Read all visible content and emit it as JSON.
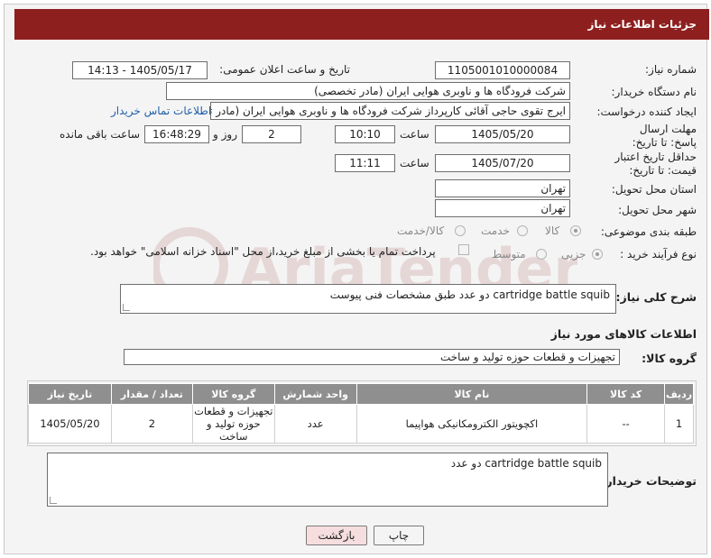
{
  "window": {
    "title": "جزئیات اطلاعات نیاز"
  },
  "fields": {
    "need_number_label": "شماره نیاز:",
    "need_number": "1105001010000084",
    "announce_label": "تاریخ و ساعت اعلان عمومی:",
    "announce_value": "1405/05/17 - 14:13",
    "buyer_label": "نام دستگاه خریدار:",
    "buyer_value": "شرکت فرودگاه ها و ناوبری هوایی ایران (مادر تخصصی)",
    "creator_label": "ایجاد کننده درخواست:",
    "creator_value": "ایرج تقوی حاجی آقائی کارپرداز شرکت فرودگاه ها و ناوبری هوایی ایران (مادر تخص",
    "contact_link": "اطلاعات تماس خریدار",
    "deadline_label": "مهلت ارسال پاسخ: تا تاریخ:",
    "deadline_date": "1405/05/20",
    "time_label": "ساعت",
    "deadline_time": "10:10",
    "days_value": "2",
    "days_label": "روز و",
    "remaining_time": "16:48:29",
    "remaining_label": "ساعت باقی مانده",
    "price_validity_label": "حداقل تاریخ اعتبار قیمت: تا تاریخ:",
    "price_validity_date": "1405/07/20",
    "price_validity_time": "11:11",
    "province_label": "استان محل تحویل:",
    "province_value": "تهران",
    "city_label": "شهر محل تحویل:",
    "city_value": "تهران",
    "category_label": "طبقه بندی موضوعی:",
    "category_options": [
      "کالا",
      "خدمت",
      "کالا/خدمت"
    ],
    "category_selected": "کالا",
    "process_label": "نوع فرآیند خرید :",
    "process_options": [
      "جزیی",
      "متوسط"
    ],
    "process_selected": "جزیی",
    "payment_text": "پرداخت تمام یا بخشی از مبلغ خرید،از محل \"اسناد خزانه اسلامی\" خواهد بود."
  },
  "description": {
    "label": "شرح کلی نیاز:",
    "value": "cartridge battle squib دو عدد طبق مشخصات فنی پیوست"
  },
  "goods": {
    "section_title": "اطلاعات کالاهای مورد نیاز",
    "group_label": "گروه کالا:",
    "group_value": "تجهیزات و قطعات حوزه تولید و ساخت",
    "headers": [
      "ردیف",
      "کد کالا",
      "نام کالا",
      "واحد شمارش",
      "گروه کالا",
      "تعداد / مقدار",
      "تاریخ نیاز"
    ],
    "rows": [
      {
        "row": "1",
        "code": "--",
        "name": "اکچویتور الکترومکانیکی هواپیما",
        "unit": "عدد",
        "group": "تجهیزات و قطعات حوزه تولید و ساخت",
        "qty": "2",
        "date": "1405/05/20"
      }
    ]
  },
  "buyer_notes": {
    "label": "توضیحات خریدار:",
    "value": "cartridge battle squib دو عدد"
  },
  "buttons": {
    "print": "چاپ",
    "back": "بازگشت"
  },
  "colors": {
    "title_bar": "#8e1f1f",
    "table_header": "#8f8f8f",
    "back_button": "#f6dede"
  },
  "watermark": "AriaTender.net"
}
